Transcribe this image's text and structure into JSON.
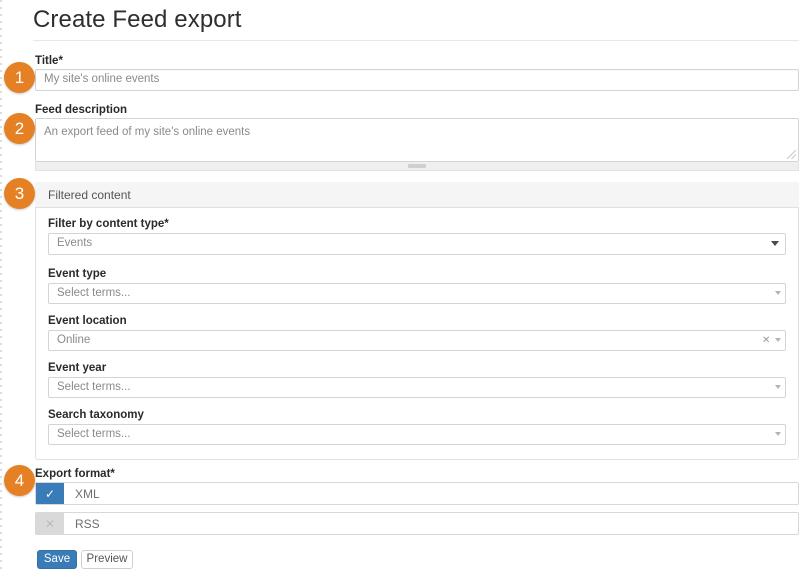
{
  "page": {
    "title": "Create Feed export",
    "required_marker": "*"
  },
  "fields": {
    "title": {
      "label": "Title",
      "required": true,
      "value": "My site's online events"
    },
    "feed_description": {
      "label": "Feed description",
      "required": false,
      "value": "An export feed of my site's online events"
    }
  },
  "filtered_content": {
    "legend": "Filtered content",
    "fields": [
      {
        "name": "filter-by-content-type",
        "label": "Filter by content type",
        "required": true,
        "value": "Events",
        "widget": "select",
        "icon": "chevron-down-icon",
        "clearable": false
      },
      {
        "name": "event-type",
        "label": "Event type",
        "required": false,
        "value": "Select terms...",
        "widget": "autocomplete",
        "icon": "chevron-down-icon",
        "clearable": false
      },
      {
        "name": "event-location",
        "label": "Event location",
        "required": false,
        "value": "Online",
        "widget": "autocomplete",
        "icon": "chevron-down-icon",
        "clearable": true,
        "clear_icon": "close-icon",
        "clear_glyph": "✕"
      },
      {
        "name": "event-year",
        "label": "Event year",
        "required": false,
        "value": "Select terms...",
        "widget": "autocomplete",
        "icon": "chevron-down-icon",
        "clearable": false
      },
      {
        "name": "search-taxonomy",
        "label": "Search taxonomy",
        "required": false,
        "value": "Select terms...",
        "widget": "autocomplete",
        "icon": "chevron-down-icon",
        "clearable": false
      }
    ]
  },
  "export_format": {
    "label": "Export format",
    "required": true,
    "options": [
      {
        "name": "xml",
        "label": "XML",
        "checked": true,
        "glyph": "✓"
      },
      {
        "name": "rss",
        "label": "RSS",
        "checked": false,
        "glyph": "✕"
      }
    ]
  },
  "actions": {
    "save": "Save",
    "preview": "Preview"
  },
  "badges": [
    {
      "number": "1"
    },
    {
      "number": "2"
    },
    {
      "number": "3"
    },
    {
      "number": "4"
    }
  ],
  "colors": {
    "badge_orange": "#e58025",
    "primary_blue": "#3a7cb8",
    "panel_header_gray": "#f5f5f5",
    "border_gray": "#d4d4d4"
  }
}
